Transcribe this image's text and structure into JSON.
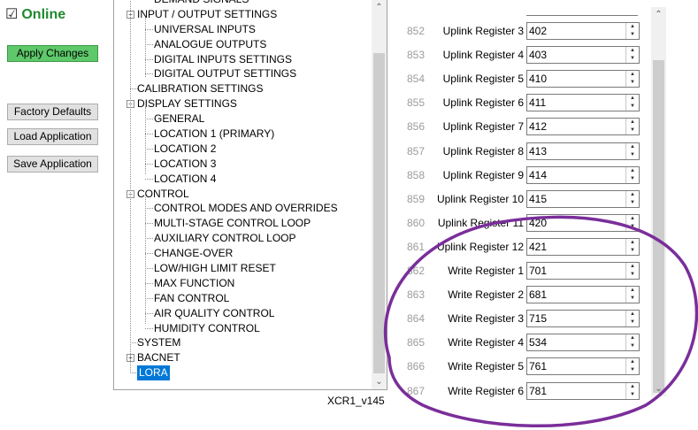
{
  "status": {
    "online_label": "Online",
    "online_checked": true,
    "checkbox_glyph": "☑"
  },
  "actions": {
    "apply": "Apply Changes",
    "factory": "Factory Defaults",
    "load": "Load Application",
    "save": "Save Application"
  },
  "tree": {
    "items": [
      "DEMAND SIGNALS",
      "INPUT / OUTPUT SETTINGS",
      "UNIVERSAL INPUTS",
      "ANALOGUE OUTPUTS",
      "DIGITAL INPUTS SETTINGS",
      "DIGITAL OUTPUT SETTINGS",
      "CALIBRATION SETTINGS",
      "DISPLAY SETTINGS",
      "GENERAL",
      "LOCATION 1 (PRIMARY)",
      "LOCATION 2",
      "LOCATION 3",
      "LOCATION 4",
      "CONTROL",
      "CONTROL MODES AND OVERRIDES",
      "MULTI-STAGE CONTROL LOOP",
      "AUXILIARY CONTROL LOOP",
      "CHANGE-OVER",
      "LOW/HIGH LIMIT RESET",
      "MAX FUNCTION",
      "FAN CONTROL",
      "AIR QUALITY CONTROL",
      "HUMIDITY CONTROL",
      "SYSTEM",
      "BACNET",
      "LORA"
    ],
    "selected": "LORA",
    "version": "XCR1_v145"
  },
  "registers": {
    "rows": [
      {
        "num": "852",
        "name": "Uplink Register 3",
        "value": "402"
      },
      {
        "num": "853",
        "name": "Uplink Register 4",
        "value": "403"
      },
      {
        "num": "854",
        "name": "Uplink Register 5",
        "value": "410"
      },
      {
        "num": "855",
        "name": "Uplink Register 6",
        "value": "411"
      },
      {
        "num": "856",
        "name": "Uplink Register 7",
        "value": "412"
      },
      {
        "num": "857",
        "name": "Uplink Register 8",
        "value": "413"
      },
      {
        "num": "858",
        "name": "Uplink Register 9",
        "value": "414"
      },
      {
        "num": "859",
        "name": "Uplink Register 10",
        "value": "415"
      },
      {
        "num": "860",
        "name": "Uplink Register 11",
        "value": "420"
      },
      {
        "num": "861",
        "name": "Uplink Register 12",
        "value": "421"
      },
      {
        "num": "862",
        "name": "Write Register 1",
        "value": "701"
      },
      {
        "num": "863",
        "name": "Write Register 2",
        "value": "681"
      },
      {
        "num": "864",
        "name": "Write Register 3",
        "value": "715"
      },
      {
        "num": "865",
        "name": "Write Register 4",
        "value": "534"
      },
      {
        "num": "866",
        "name": "Write Register 5",
        "value": "761"
      },
      {
        "num": "867",
        "name": "Write Register 6",
        "value": "781"
      }
    ]
  },
  "icons": {
    "spin_up": "▲",
    "spin_down": "▼",
    "scroll_up": "⌃",
    "scroll_down": "⌄",
    "expand_open": "−",
    "expand_closed": "+"
  },
  "colors": {
    "online": "#1e8a2e",
    "accent_button": "#5ec86a",
    "selection": "#0078d7",
    "annotation": "#7a2e9a"
  }
}
